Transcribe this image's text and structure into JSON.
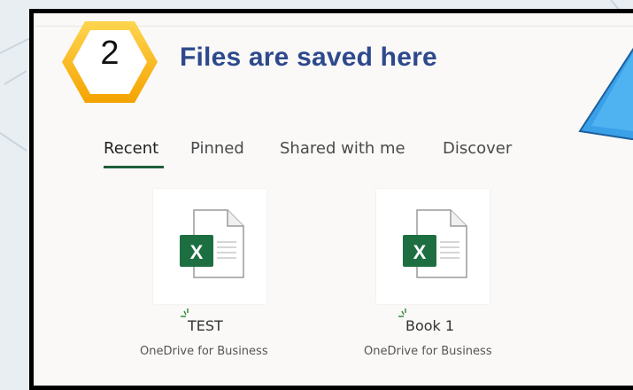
{
  "callout": {
    "step_number": "2",
    "heading": "Files are saved here"
  },
  "tabs": [
    {
      "label": "Recent",
      "active": true
    },
    {
      "label": "Pinned",
      "active": false
    },
    {
      "label": "Shared with me",
      "active": false
    },
    {
      "label": "Discover",
      "active": false
    }
  ],
  "files": [
    {
      "name": "TEST",
      "location": "OneDrive for Business",
      "icon": "excel-file-icon"
    },
    {
      "name": "Book 1",
      "location": "OneDrive for Business",
      "icon": "excel-file-icon"
    }
  ],
  "colors": {
    "heading": "#2e4a8c",
    "badge_gold": "#f4b400",
    "excel_green": "#1d6f42",
    "active_tab_underline": "#1e5e3a",
    "arrow_blue": "#3aa0e8"
  }
}
